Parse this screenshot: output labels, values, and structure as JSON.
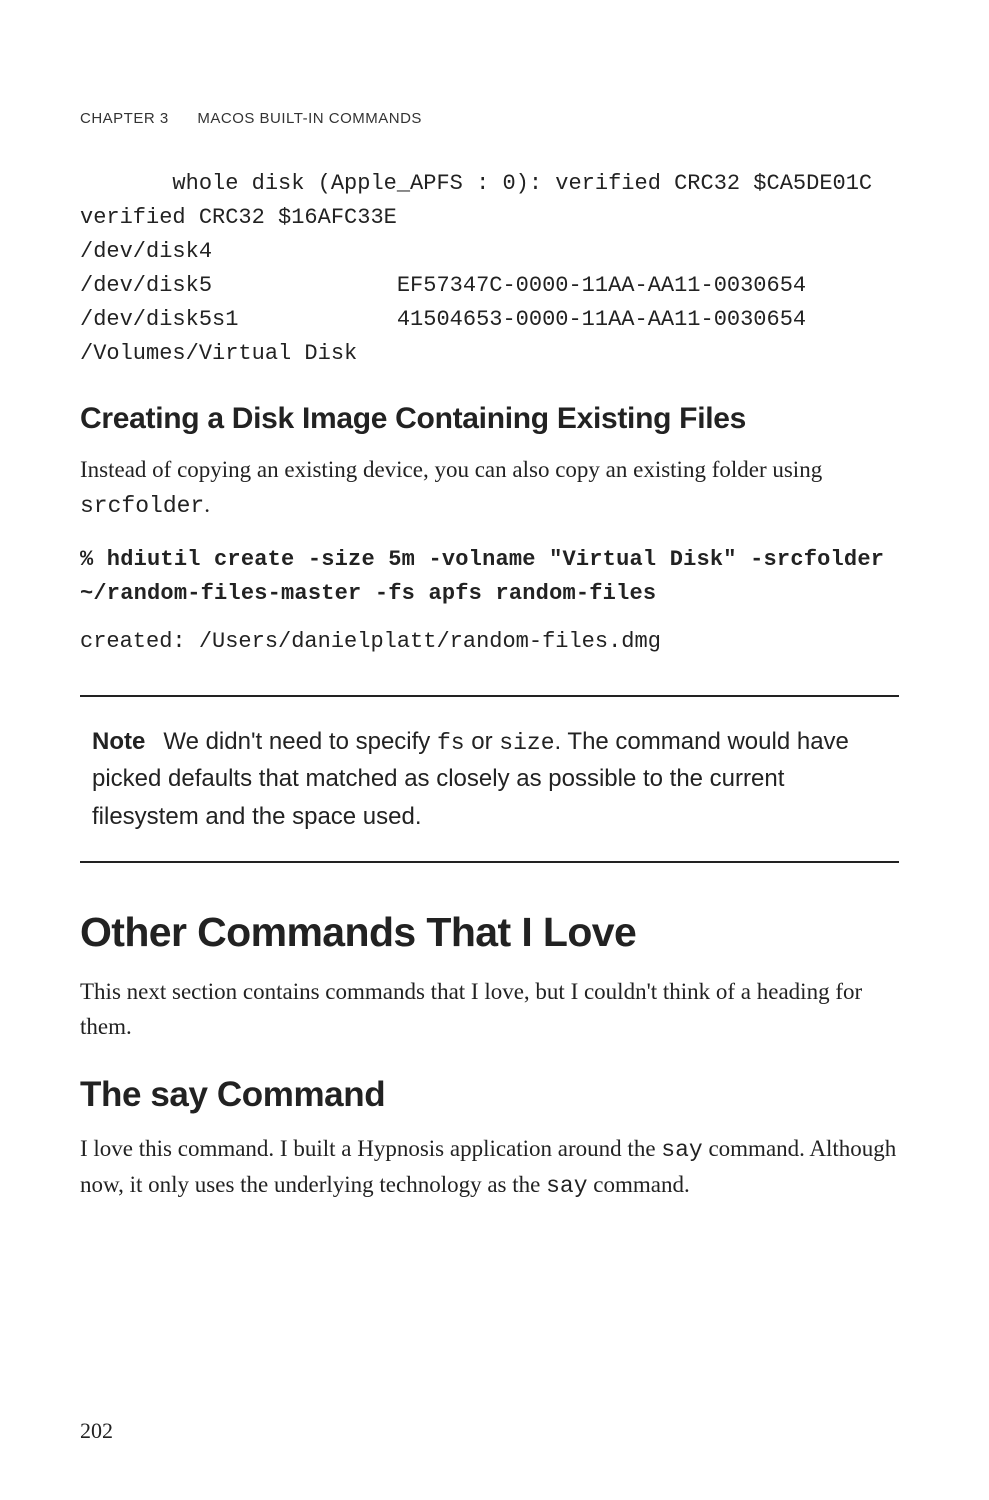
{
  "header": {
    "chapter": "CHAPTER 3",
    "title": "MACOS BUILT-IN COMMANDS"
  },
  "codeblock1": "       whole disk (Apple_APFS : 0): verified CRC32 $CA5DE01C\nverified CRC32 $16AFC33E\n/dev/disk4\n/dev/disk5              EF57347C-0000-11AA-AA11-0030654\n/dev/disk5s1            41504653-0000-11AA-AA11-0030654\n/Volumes/Virtual Disk",
  "subhead1": "Creating a Disk Image Containing Existing Files",
  "para1_a": "Instead of copying an existing device, you can also copy an existing folder using ",
  "para1_code": "srcfolder",
  "para1_b": ".",
  "cmd1": "% hdiutil create -size 5m -volname \"Virtual Disk\" -srcfolder ~/random-files-master -fs apfs random-files",
  "output1": "created: /Users/danielplatt/random-files.dmg",
  "note": {
    "label": "Note",
    "t1": "We didn't need to specify ",
    "c1": "fs",
    "t2": " or ",
    "c2": "size",
    "t3": ". The command would have picked defaults that matched as closely as possible to the current filesystem and the space used."
  },
  "sec1": "Other Commands That I Love",
  "para2": "This next section contains commands that I love, but I couldn't think of a heading for them.",
  "subsec1": "The say Command",
  "para3_a": "I love this command. I built a Hypnosis application around the ",
  "para3_c1": "say",
  "para3_b": " command. Although now, it only uses the underlying technology as the ",
  "para3_c2": "say",
  "para3_c": " command.",
  "pageNumber": "202"
}
